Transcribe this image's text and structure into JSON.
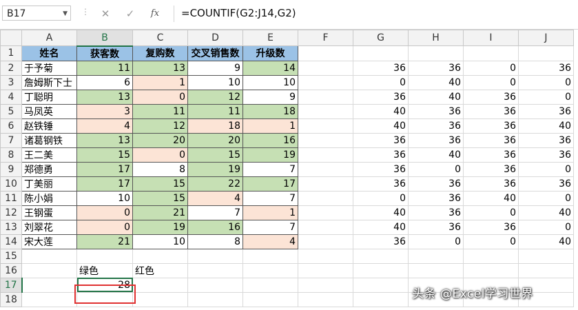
{
  "namebox": "B17",
  "formula": "=COUNTIF(G2:J14,G2)",
  "columns": [
    "A",
    "B",
    "C",
    "D",
    "E",
    "F",
    "G",
    "H",
    "I",
    "J"
  ],
  "header_row": [
    "姓名",
    "获客数",
    "复购数",
    "交叉销售数",
    "升级数"
  ],
  "rows": [
    {
      "n": "1"
    },
    {
      "n": "2",
      "name": "于予菊",
      "b": "11",
      "c": "13",
      "d": "9",
      "e": "14",
      "g": "36",
      "h": "36",
      "i": "0",
      "j": "36"
    },
    {
      "n": "3",
      "name": "詹姆斯下士",
      "b": "6",
      "c": "1",
      "d": "10",
      "e": "10",
      "g": "0",
      "h": "40",
      "i": "0",
      "j": "0"
    },
    {
      "n": "4",
      "name": "丁聪明",
      "b": "13",
      "c": "0",
      "d": "12",
      "e": "9",
      "g": "36",
      "h": "40",
      "i": "36",
      "j": "0"
    },
    {
      "n": "5",
      "name": "马凤英",
      "b": "3",
      "c": "11",
      "d": "11",
      "e": "18",
      "g": "40",
      "h": "36",
      "i": "36",
      "j": "36"
    },
    {
      "n": "6",
      "name": "赵铁锤",
      "b": "4",
      "c": "12",
      "d": "18",
      "e": "1",
      "g": "40",
      "h": "36",
      "i": "36",
      "j": "40"
    },
    {
      "n": "7",
      "name": "诸葛钢铁",
      "b": "13",
      "c": "20",
      "d": "20",
      "e": "16",
      "g": "36",
      "h": "36",
      "i": "36",
      "j": "36"
    },
    {
      "n": "8",
      "name": "王二美",
      "b": "15",
      "c": "0",
      "d": "15",
      "e": "19",
      "g": "36",
      "h": "40",
      "i": "36",
      "j": "36"
    },
    {
      "n": "9",
      "name": "郑德勇",
      "b": "17",
      "c": "8",
      "d": "19",
      "e": "7",
      "g": "36",
      "h": "0",
      "i": "36",
      "j": "0"
    },
    {
      "n": "10",
      "name": "丁美丽",
      "b": "17",
      "c": "15",
      "d": "22",
      "e": "17",
      "g": "36",
      "h": "36",
      "i": "36",
      "j": "36"
    },
    {
      "n": "11",
      "name": "陈小娟",
      "b": "10",
      "c": "15",
      "d": "4",
      "e": "7",
      "g": "0",
      "h": "36",
      "i": "40",
      "j": "0"
    },
    {
      "n": "12",
      "name": "王钢蛋",
      "b": "0",
      "c": "21",
      "d": "7",
      "e": "1",
      "g": "40",
      "h": "36",
      "i": "0",
      "j": "40"
    },
    {
      "n": "13",
      "name": "刘翠花",
      "b": "0",
      "c": "19",
      "d": "16",
      "e": "7",
      "g": "40",
      "h": "36",
      "i": "36",
      "j": "0"
    },
    {
      "n": "14",
      "name": "宋大莲",
      "b": "21",
      "c": "10",
      "d": "8",
      "e": "4",
      "g": "36",
      "h": "0",
      "i": "0",
      "j": "40"
    }
  ],
  "row15": "15",
  "row16": {
    "n": "16",
    "b": "绿色",
    "c": "红色"
  },
  "row17": {
    "n": "17",
    "b": "28"
  },
  "row18": "18",
  "watermark": "头条 @Excel学习世界",
  "colors": {
    "header": "#9bc2e6",
    "green": "#c6e0b4",
    "red": "#fce4d6",
    "accent": "#217346",
    "highlight": "#e03030"
  }
}
